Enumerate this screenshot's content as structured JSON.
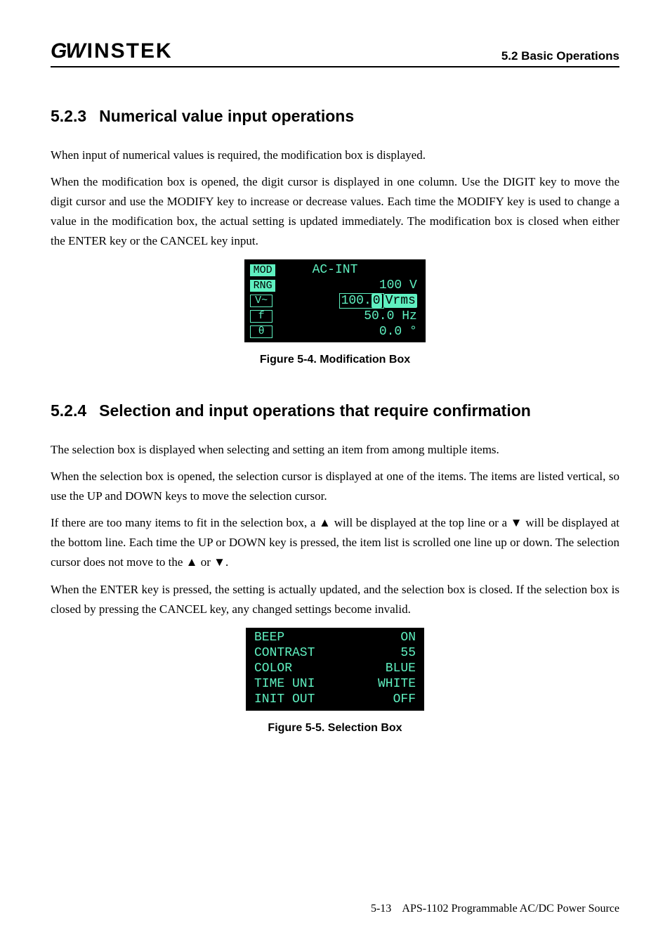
{
  "header": {
    "logo_gw": "GW",
    "logo_instek": "INSTEK",
    "section": "5.2 Basic Operations"
  },
  "s523": {
    "num": "5.2.3",
    "title": "Numerical value input operations",
    "p1": "When input of numerical values is required, the modification box is displayed.",
    "p2": "When the modification box is opened, the digit cursor is displayed in one column.  Use the DIGIT key to move the digit cursor and use the MODIFY key to increase or decrease values.  Each time the MODIFY key is used to change a value in the modification box, the actual setting is updated immediately.  The modification box is closed when either the ENTER key or the CANCEL key input.",
    "fig": {
      "rows": {
        "mod_tag": "MOD",
        "mod_val": "AC-INT",
        "rng_tag": "RNG",
        "rng_val": "100 V",
        "v_tag": "V~",
        "v_val_a": "100.",
        "v_val_digit": "0",
        "v_val_unit": "Vrms",
        "f_tag": "f",
        "f_val": "50.0 Hz",
        "th_tag": "θ",
        "th_val": "0.0 °"
      },
      "caption": "Figure 5-4.  Modification Box"
    }
  },
  "s524": {
    "num": "5.2.4",
    "title": "Selection and input operations that require confirmation",
    "p1": "The selection box is displayed when selecting and setting an item from among multiple items.",
    "p2": "When the selection box is opened, the selection cursor is displayed at one of the items.  The items are listed vertical, so use the UP and DOWN keys to move the selection cursor.",
    "p3a": "If there are too many items to fit in the selection box, a ",
    "p3b": "  will be displayed at the top line or a ",
    "p3c": " will be displayed at the bottom line.  Each time the UP or DOWN key is pressed, the item list is scrolled one line up or down.  The selection cursor does not move to the ",
    "p3d": "  or ",
    "p3e": ".",
    "p4": "When the ENTER key is pressed, the setting is actually updated, and the selection box is closed.  If the selection box is closed by pressing the CANCEL key, any changed settings become invalid.",
    "fig": {
      "rows": {
        "beep_l": "BEEP",
        "beep_v": "ON",
        "cont_l": "CONTRAST",
        "cont_v": "55",
        "col_l": "COLOR",
        "col_v": "BLUE",
        "tu_l": "TIME UNI",
        "tu_v": "WHITE",
        "io_l": "INIT OUT",
        "io_v": "OFF"
      },
      "caption": "Figure 5-5.  Selection Box"
    }
  },
  "footer": {
    "page": "5-13",
    "doc": "APS-1102 Programmable AC/DC Power Source"
  }
}
